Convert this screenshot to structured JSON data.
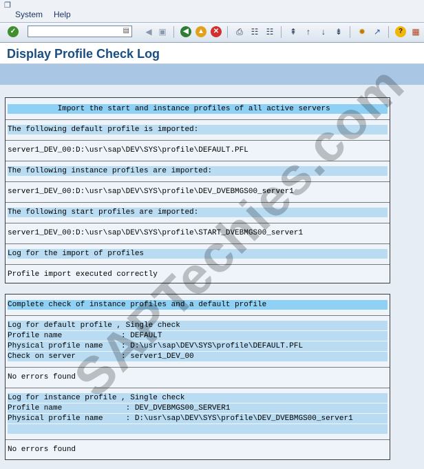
{
  "menu": {
    "items": [
      "System",
      "Help"
    ]
  },
  "page": {
    "title": "Display Profile Check Log"
  },
  "panel1": {
    "rows": [
      {
        "text": "           Import the start and instance profiles of all active servers",
        "style": "hl"
      },
      {
        "text": "The following default profile is imported:",
        "style": "sub"
      },
      {
        "text": "server1_DEV_00:D:\\usr\\sap\\DEV\\SYS\\profile\\DEFAULT.PFL",
        "style": "plain"
      },
      {
        "text": "The following instance profiles are imported:",
        "style": "sub"
      },
      {
        "text": "server1_DEV_00:D:\\usr\\sap\\DEV\\SYS\\profile\\DEV_DVEBMGS00_server1",
        "style": "plain"
      },
      {
        "text": "The following start profiles are imported:",
        "style": "sub"
      },
      {
        "text": "server1_DEV_00:D:\\usr\\sap\\DEV\\SYS\\profile\\START_DVEBMGS00_server1",
        "style": "plain"
      },
      {
        "text": "Log for the import of profiles",
        "style": "sub"
      },
      {
        "text": "Profile import executed correctly",
        "style": "plain"
      }
    ]
  },
  "panel2": {
    "rows": [
      {
        "text": "Complete check of instance profiles and a default profile",
        "style": "hl"
      },
      {
        "text": "Log for default profile , Single check",
        "style": "sub"
      },
      {
        "text": "Profile name             : DEFAULT",
        "style": "sub"
      },
      {
        "text": "Physical profile name    : D:\\usr\\sap\\DEV\\SYS\\profile\\DEFAULT.PFL",
        "style": "sub"
      },
      {
        "text": "Check on server          : server1_DEV_00",
        "style": "sub"
      },
      {
        "text": "No errors found",
        "style": "plain"
      },
      {
        "text": "Log for instance profile , Single check",
        "style": "sub"
      },
      {
        "text": "Profile name              : DEV_DVEBMGS00_SERVER1",
        "style": "sub"
      },
      {
        "text": "Physical profile name     : D:\\usr\\sap\\DEV\\SYS\\profile\\DEV_DVEBMGS00_server1",
        "style": "sub"
      },
      {
        "text": "",
        "style": "sub"
      },
      {
        "text": "No errors found",
        "style": "plain"
      }
    ]
  },
  "watermark": "SAPTechies.com"
}
